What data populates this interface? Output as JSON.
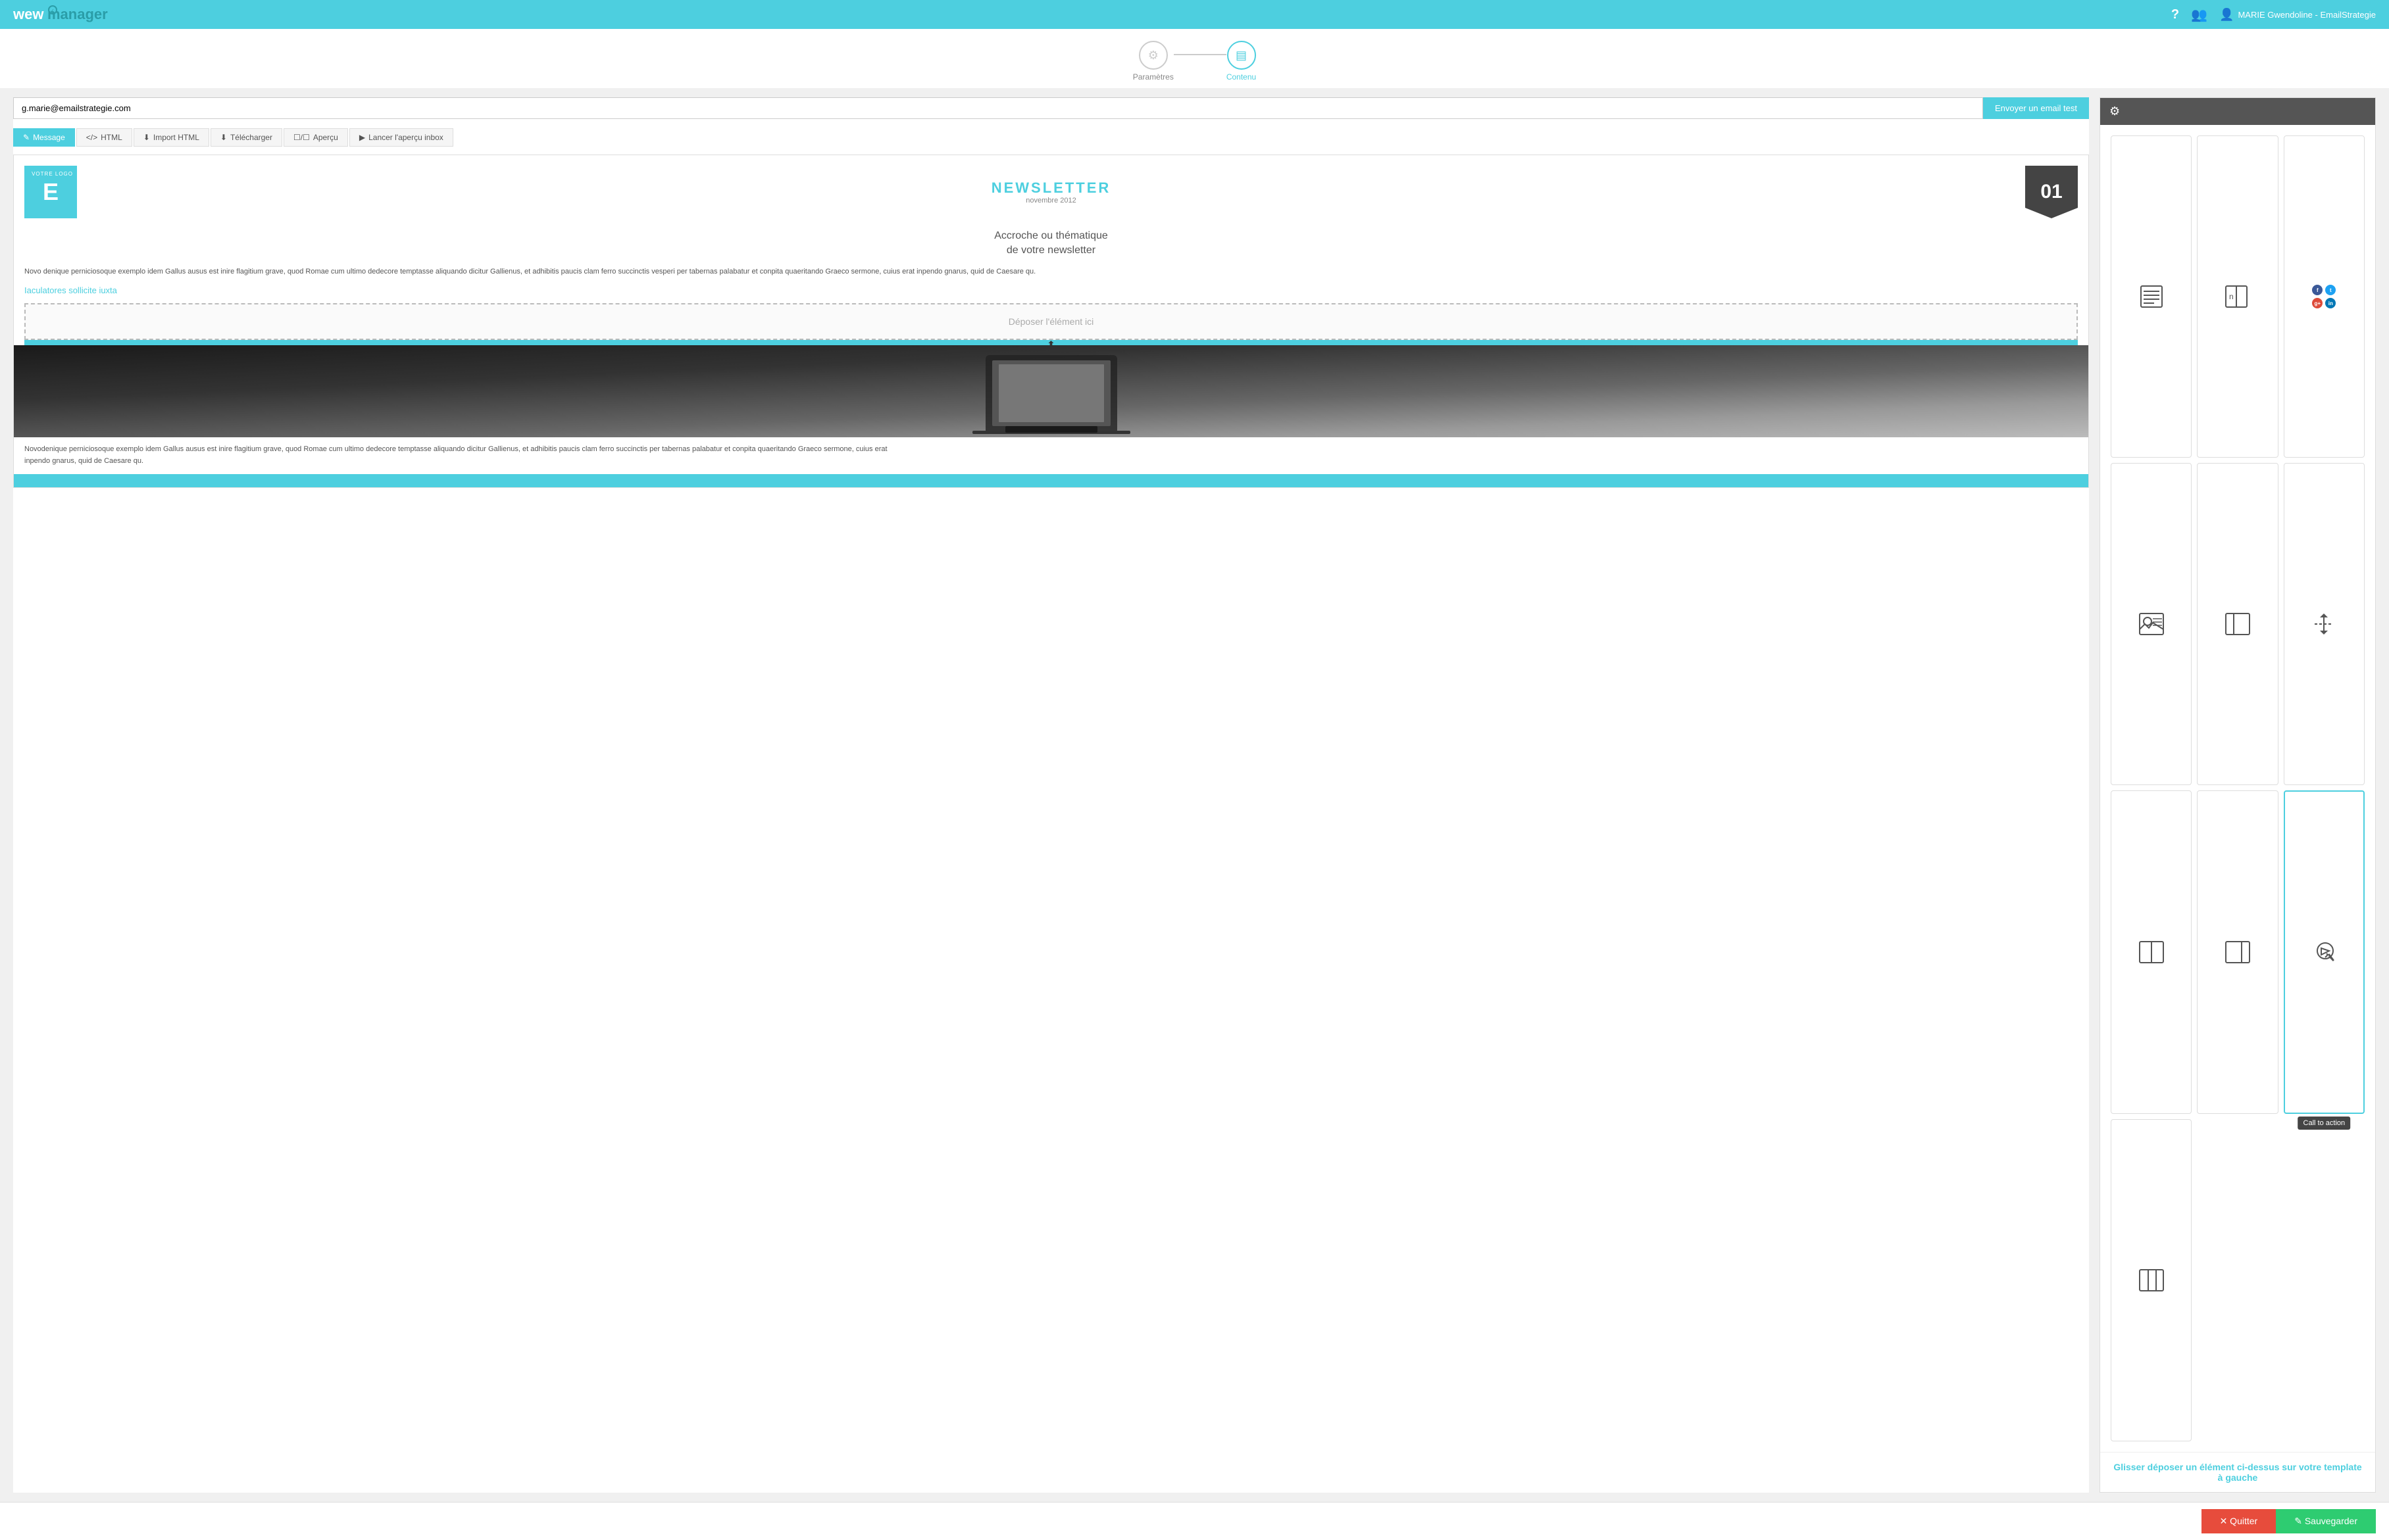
{
  "app": {
    "logo": "wewmanager",
    "nav": {
      "help_icon": "question-mark",
      "users_icon": "users",
      "user_name": "MARIE Gwendoline - EmailStrategie"
    }
  },
  "stepper": {
    "steps": [
      {
        "id": "parametres",
        "label": "Paramètres",
        "icon": "⚙",
        "active": false
      },
      {
        "id": "contenu",
        "label": "Contenu",
        "icon": "▤",
        "active": true
      }
    ]
  },
  "email_test": {
    "input_value": "g.marie@emailstrategie.com",
    "input_placeholder": "g.marie@emailstrategie.com",
    "button_label": "Envoyer un email test"
  },
  "toolbar": {
    "tabs": [
      {
        "id": "message",
        "label": "Message",
        "icon": "✎",
        "active": true
      },
      {
        "id": "html",
        "label": "HTML",
        "icon": "</>",
        "active": false
      },
      {
        "id": "import_html",
        "label": "Import HTML",
        "icon": "⬇",
        "active": false
      },
      {
        "id": "telecharger",
        "label": "Télécharger",
        "icon": "⬇",
        "active": false
      },
      {
        "id": "apercu",
        "label": "Aperçu",
        "icon": "☐/☐/☐",
        "active": false
      },
      {
        "id": "lancer_apercu",
        "label": "Lancer l'aperçu inbox",
        "icon": "▶",
        "active": false
      }
    ]
  },
  "newsletter": {
    "logo_letter": "E",
    "votre_logo": "VOTRE LOGO",
    "title": "NEWSLETTER",
    "month": "novembre 2012",
    "issue": "01",
    "accroche_line1": "Accroche ou thématique",
    "accroche_line2": "de votre newsletter",
    "body_text": "Novo denique perniciosoque exemplo idem Gallus ausus est inire flagitium grave, quod Romae cum ultimo dedecore temptasse aliquando dicitur Gallienus, et adhibitis paucis clam ferro succinctis vesperi per tabernas palabatur et conpita quaeritando Graeco sermone, cuius erat inpendo gnarus, quid de Caesare qu.",
    "link_text": "Iaculatores sollicite iuxta",
    "drop_zone_text": "Déposer l'élément ici",
    "coords": "500\n521",
    "bottom_text": "Novodenique perniciosoque exemplo idem Gallus ausus est inire flagitium grave, quod Romae cum ultimo dedecore temptasse aliquando dicitur Gallienus, et adhibitis paucis clam ferro succinctis per tabernas palabatur et conpita quaeritando Graeco sermone, cuius erat\ninpendo gnarus, quid de Caesare qu."
  },
  "right_panel": {
    "elements": [
      {
        "id": "text-block",
        "type": "text",
        "tooltip": ""
      },
      {
        "id": "two-col",
        "type": "two-col",
        "tooltip": ""
      },
      {
        "id": "social",
        "type": "social",
        "tooltip": ""
      },
      {
        "id": "image-text",
        "type": "image-text",
        "tooltip": ""
      },
      {
        "id": "one-col-sidebar",
        "type": "one-col-sidebar",
        "tooltip": ""
      },
      {
        "id": "resize",
        "type": "resize",
        "tooltip": ""
      },
      {
        "id": "two-col-b",
        "type": "two-col-b",
        "tooltip": ""
      },
      {
        "id": "two-col-c",
        "type": "two-col-c",
        "tooltip": ""
      },
      {
        "id": "call-to-action",
        "type": "cta",
        "tooltip": "Call to action"
      },
      {
        "id": "three-col",
        "type": "three-col",
        "tooltip": ""
      }
    ],
    "drop_hint": "Glisser déposer un élément ci-dessus sur votre template à gauche"
  },
  "bottom_bar": {
    "quit_label": "✕  Quitter",
    "save_label": "✎  Sauvegarder"
  }
}
